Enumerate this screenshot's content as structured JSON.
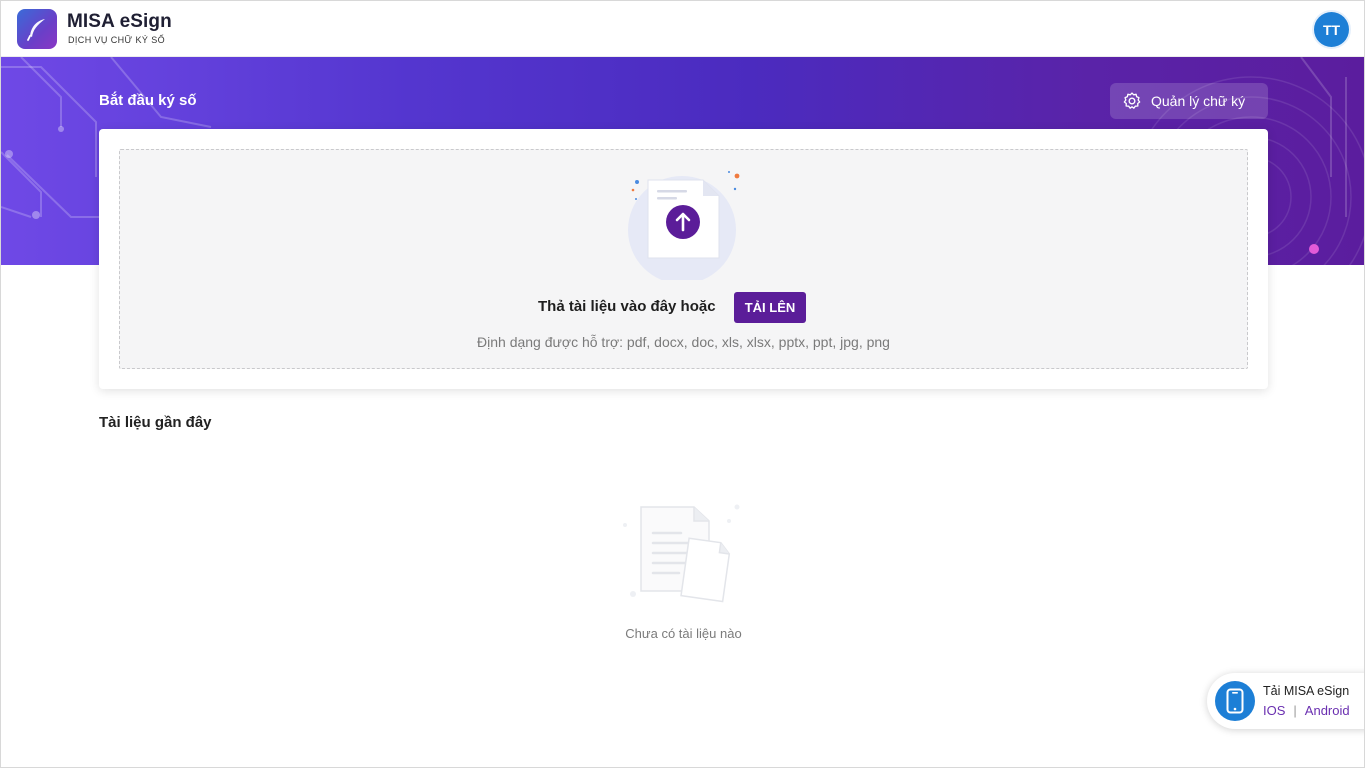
{
  "header": {
    "brand_name": "MISA eSign",
    "brand_subtitle": "DỊCH VỤ CHỮ KÝ SỐ",
    "avatar_initials": "TT"
  },
  "banner": {
    "title": "Bắt đầu ký số",
    "manage_button_label": "Quản lý chữ ký",
    "manage_button_icon": "gear-icon"
  },
  "upload": {
    "drop_text": "Thả tài liệu vào đây hoặc",
    "upload_button_label": "TẢI LÊN",
    "supported_formats": "Định dạng được hỗ trợ: pdf, docx, doc, xls, xlsx, pptx, ppt, jpg, png",
    "icon": "upload-arrow-icon"
  },
  "recent": {
    "title": "Tài liệu gần đây",
    "empty_text": "Chưa có tài liệu nào"
  },
  "app_widget": {
    "title": "Tải MISA eSign",
    "ios_label": "IOS",
    "separator": "|",
    "android_label": "Android",
    "icon": "phone-icon"
  },
  "colors": {
    "banner_start": "#6f49e6",
    "banner_end": "#5b1d9e",
    "primary_button": "#5b1d99",
    "avatar": "#1d7fd6",
    "link": "#6a2fb0"
  }
}
